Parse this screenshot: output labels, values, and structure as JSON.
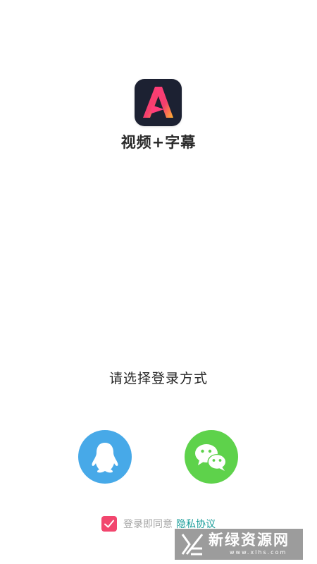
{
  "app": {
    "name": "视频+字幕",
    "logo_letter": "A"
  },
  "login": {
    "prompt": "请选择登录方式",
    "methods": [
      {
        "name": "QQ",
        "icon": "qq-penguin-icon",
        "color": "#47a9e8"
      },
      {
        "name": "WeChat",
        "icon": "wechat-bubbles-icon",
        "color": "#5ed24b"
      }
    ]
  },
  "agreement": {
    "checked": true,
    "text": "登录即同意",
    "link": "隐私协议",
    "checkbox_color": "#f2466e",
    "link_color": "#1b9e9a"
  },
  "watermark": {
    "text": "新绿资源网",
    "subtext": "www.xlhs.com"
  }
}
